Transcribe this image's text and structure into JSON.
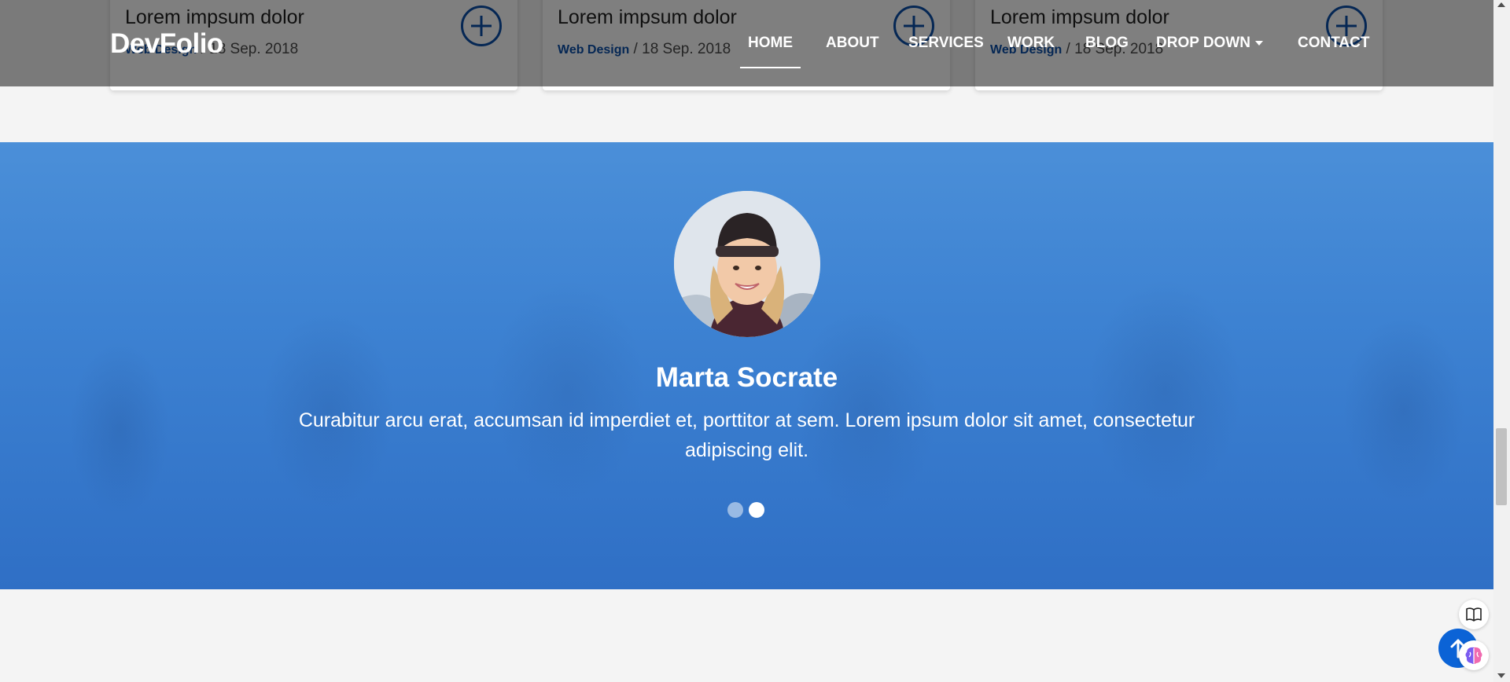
{
  "navbar": {
    "brand": "DevFolio",
    "items": [
      {
        "label": "HOME",
        "active": true
      },
      {
        "label": "ABOUT"
      },
      {
        "label": "SERVICES"
      },
      {
        "label": "WORK"
      },
      {
        "label": "BLOG"
      },
      {
        "label": "DROP DOWN"
      },
      {
        "label": "CONTACT"
      }
    ]
  },
  "work_cards": [
    {
      "title": "Lorem impsum dolor",
      "category": "Web Design",
      "date": "18 Sep. 2018"
    },
    {
      "title": "Lorem impsum dolor",
      "category": "Web Design",
      "date": "18 Sep. 2018"
    },
    {
      "title": "Lorem impsum dolor",
      "category": "Web Design",
      "date": "18 Sep. 2018"
    }
  ],
  "testimonial": {
    "name": "Marta Socrate",
    "text": "Curabitur arcu erat, accumsan id imperdiet et, porttitor at sem. Lorem ipsum dolor sit amet, consectetur adipiscing elit.",
    "pagination": {
      "count": 2,
      "active_index": 1
    }
  },
  "separators": {
    "meta": " / "
  },
  "colors": {
    "accent": "#0b4ea8",
    "testimonial_bg": "#3d82d2",
    "navbar_overlay": "rgba(0,0,0,0.5)"
  },
  "icons": {
    "card_action": "plus-circle-icon",
    "back_to_top": "arrow-up-icon",
    "reader": "book-open-icon",
    "assistant": "brain-icon",
    "dropdown": "caret-down-icon"
  }
}
